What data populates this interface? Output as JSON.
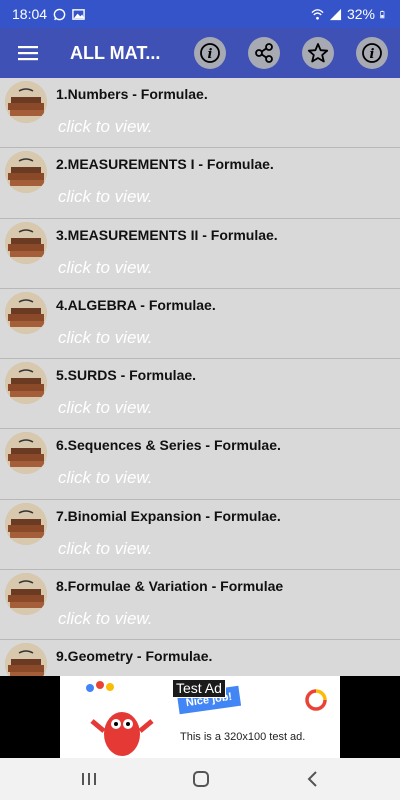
{
  "status_bar": {
    "time": "18:04",
    "battery": "32%",
    "icons_left": [
      "whatsapp-icon",
      "gallery-icon"
    ],
    "icons_right": [
      "wifi-icon",
      "signal-icon",
      "battery-icon"
    ]
  },
  "app_bar": {
    "title": "ALL MAT...",
    "actions": [
      "info-icon",
      "share-icon",
      "star-icon",
      "info-icon"
    ]
  },
  "list": {
    "items": [
      {
        "title": "1.Numbers - Formulae.",
        "subtitle": "click to view."
      },
      {
        "title": "2.MEASUREMENTS I - Formulae.",
        "subtitle": "click to view."
      },
      {
        "title": "3.MEASUREMENTS II - Formulae.",
        "subtitle": "click to view."
      },
      {
        "title": "4.ALGEBRA - Formulae.",
        "subtitle": "click to view."
      },
      {
        "title": "5.SURDS - Formulae.",
        "subtitle": "click to view."
      },
      {
        "title": "6.Sequences & Series - Formulae.",
        "subtitle": "click to view."
      },
      {
        "title": "7.Binomial Expansion - Formulae.",
        "subtitle": "click to view."
      },
      {
        "title": "8.Formulae & Variation - Formulae",
        "subtitle": "click to view."
      },
      {
        "title": "9.Geometry - Formulae.",
        "subtitle": ""
      }
    ]
  },
  "ad": {
    "label": "Test Ad",
    "badge": "Nice job!",
    "text": "This is a 320x100 test ad."
  },
  "colors": {
    "status_bar": "#3554c9",
    "app_bar": "#3f51b5",
    "list_bg": "#d9d9d9",
    "subtitle": "#ffffff"
  }
}
